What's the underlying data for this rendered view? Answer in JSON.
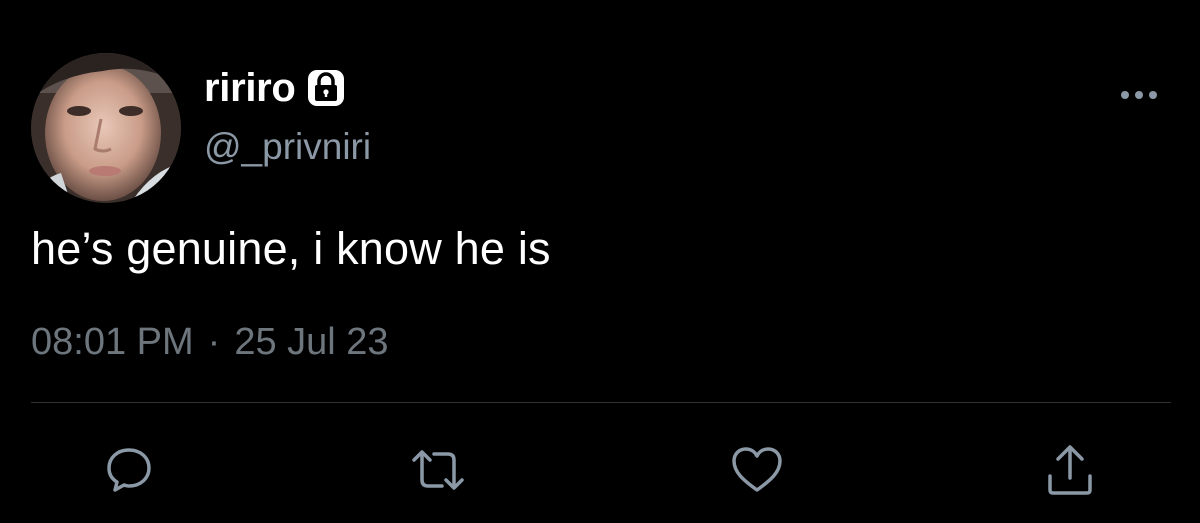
{
  "user": {
    "display_name": "ririro",
    "handle": "@_privniri",
    "protected_icon": "lock-icon",
    "avatar_icon": "profile-photo"
  },
  "tweet": {
    "text": "he’s genuine, i know he is",
    "time": "08:01 PM",
    "separator": "·",
    "date": "25 Jul 23"
  },
  "actions": [
    {
      "name": "reply",
      "icon": "reply-icon"
    },
    {
      "name": "retweet",
      "icon": "retweet-icon"
    },
    {
      "name": "like",
      "icon": "heart-icon"
    },
    {
      "name": "share",
      "icon": "share-icon"
    }
  ],
  "menu_icon": "more-options-icon",
  "colors": {
    "background": "#000000",
    "primary_text": "#ffffff",
    "secondary_text": "#8b98a5",
    "timestamp_text": "#6e767d",
    "icon": "#8b98a5",
    "divider": "#2f3336"
  }
}
